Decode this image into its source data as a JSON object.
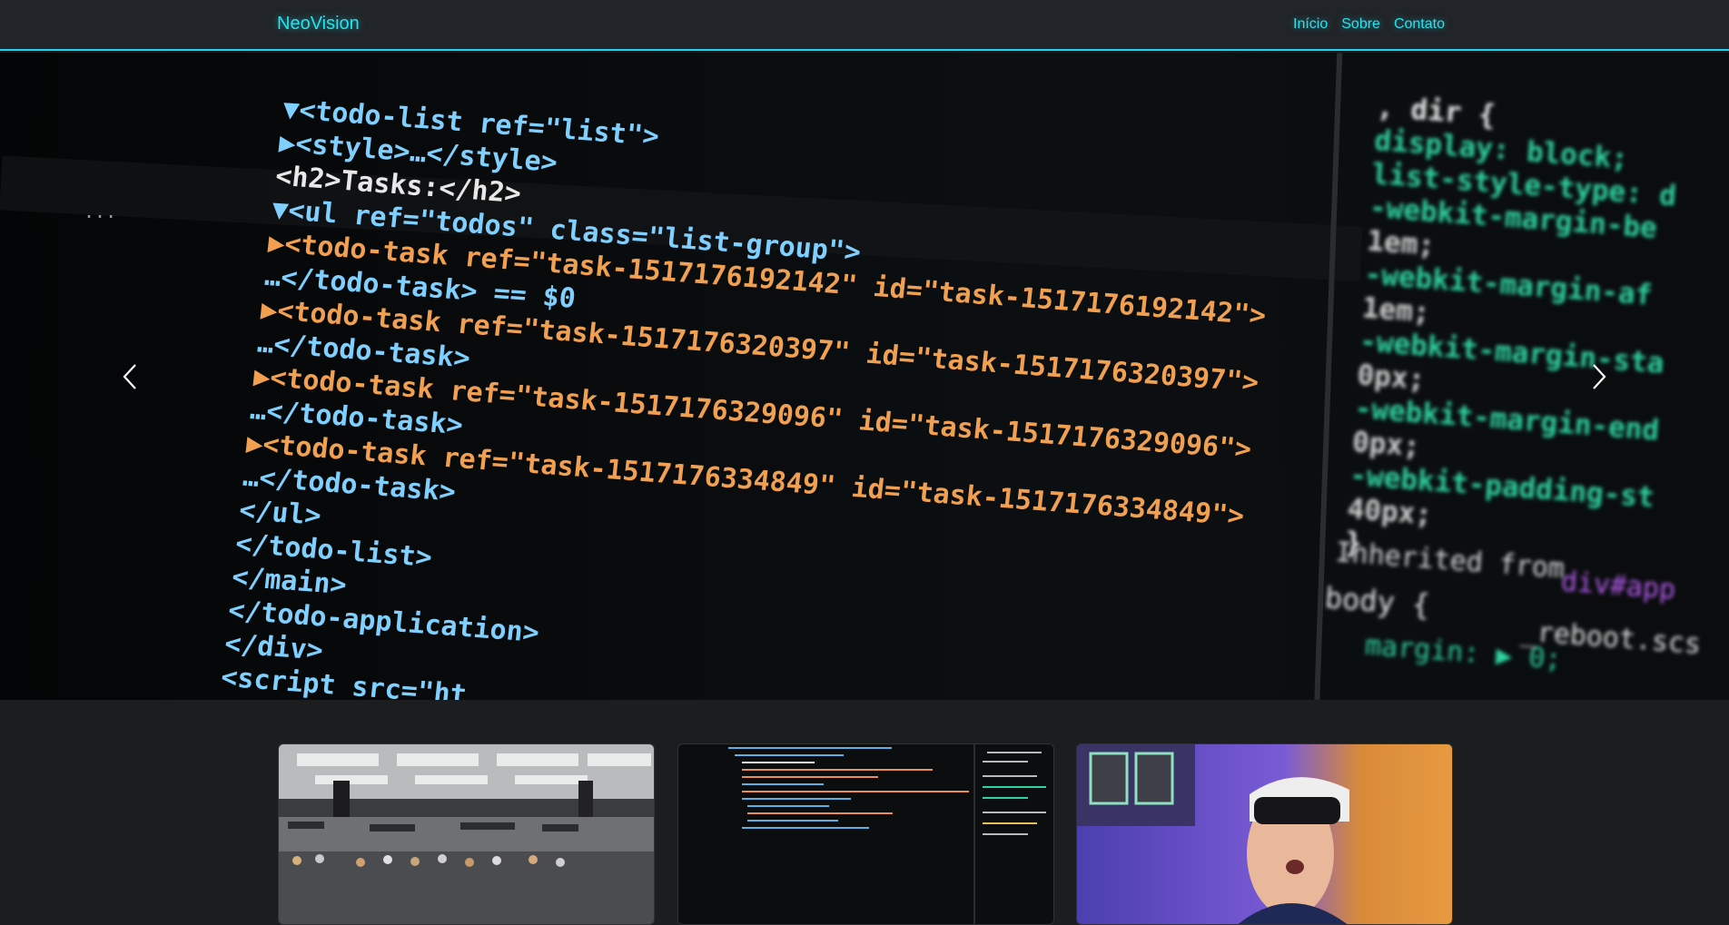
{
  "navbar": {
    "brand": "NeoVision",
    "links": [
      {
        "label": "Início"
      },
      {
        "label": "Sobre"
      },
      {
        "label": "Contato"
      }
    ]
  },
  "carousel": {
    "code_lines": [
      {
        "text": "▼<todo-list ref=\"list\">",
        "color": "#7fd0ff"
      },
      {
        "text": "  ▶<style>…</style>",
        "color": "#7fd0ff"
      },
      {
        "text": "   <h2>Tasks:</h2>",
        "color": "#e8e8e8"
      },
      {
        "text": " ▼<ul ref=\"todos\" class=\"list-group\">",
        "color": "#7fd0ff"
      },
      {
        "text": "   ▶<todo-task ref=\"task-1517176192142\" id=\"task-1517176192142\">",
        "color": "#f0a050"
      },
      {
        "text": "  …</todo-task> == $0",
        "color": "#7fd0ff"
      },
      {
        "text": "   ▶<todo-task ref=\"task-1517176320397\" id=\"task-1517176320397\">",
        "color": "#f0a050"
      },
      {
        "text": "  …</todo-task>",
        "color": "#7fd0ff"
      },
      {
        "text": "   ▶<todo-task ref=\"task-1517176329096\" id=\"task-1517176329096\">",
        "color": "#f0a050"
      },
      {
        "text": "  …</todo-task>",
        "color": "#7fd0ff"
      },
      {
        "text": "   ▶<todo-task ref=\"task-1517176334849\" id=\"task-1517176334849\">",
        "color": "#f0a050"
      },
      {
        "text": "  …</todo-task>",
        "color": "#7fd0ff"
      },
      {
        "text": "  </ul>",
        "color": "#7fd0ff"
      },
      {
        "text": " </todo-list>",
        "color": "#7fd0ff"
      },
      {
        "text": "</main>",
        "color": "#7fd0ff"
      },
      {
        "text": "</todo-application>",
        "color": "#7fd0ff"
      },
      {
        "text": "</div>",
        "color": "#7fd0ff"
      },
      {
        "text": "<script src=\"ht",
        "color": "#7fd0ff"
      }
    ],
    "css_lines": [
      {
        "text": ", dir {",
        "color": "#e8e8e8"
      },
      {
        "text": "  display: block;",
        "color": "#2fd3a0"
      },
      {
        "text": "  list-style-type: d",
        "color": "#2fd3a0"
      },
      {
        "text": "  -webkit-margin-be",
        "color": "#2fd3a0"
      },
      {
        "text": "     1em;",
        "color": "#cfcfcf"
      },
      {
        "text": "  -webkit-margin-af",
        "color": "#2fd3a0"
      },
      {
        "text": "     1em;",
        "color": "#cfcfcf"
      },
      {
        "text": "  -webkit-margin-sta",
        "color": "#2fd3a0"
      },
      {
        "text": "     0px;",
        "color": "#cfcfcf"
      },
      {
        "text": "  -webkit-margin-end",
        "color": "#2fd3a0"
      },
      {
        "text": "     0px;",
        "color": "#cfcfcf"
      },
      {
        "text": "  -webkit-padding-st",
        "color": "#2fd3a0"
      },
      {
        "text": "     40px;",
        "color": "#cfcfcf"
      },
      {
        "text": "}",
        "color": "#e8e8e8"
      }
    ],
    "inherited_label": "Inherited from",
    "inherited_tag": "div#app",
    "body_rule": "body {",
    "reboot_ref": "_reboot.scs",
    "margin_line": "margin: ▶ 0;",
    "dots": "...",
    "prev_icon": "chevron-left-icon",
    "next_icon": "chevron-right-icon"
  },
  "cards": [
    {
      "image": "office-workspace-photo"
    },
    {
      "image": "code-editor-photo"
    },
    {
      "image": "vr-headset-photo"
    }
  ]
}
